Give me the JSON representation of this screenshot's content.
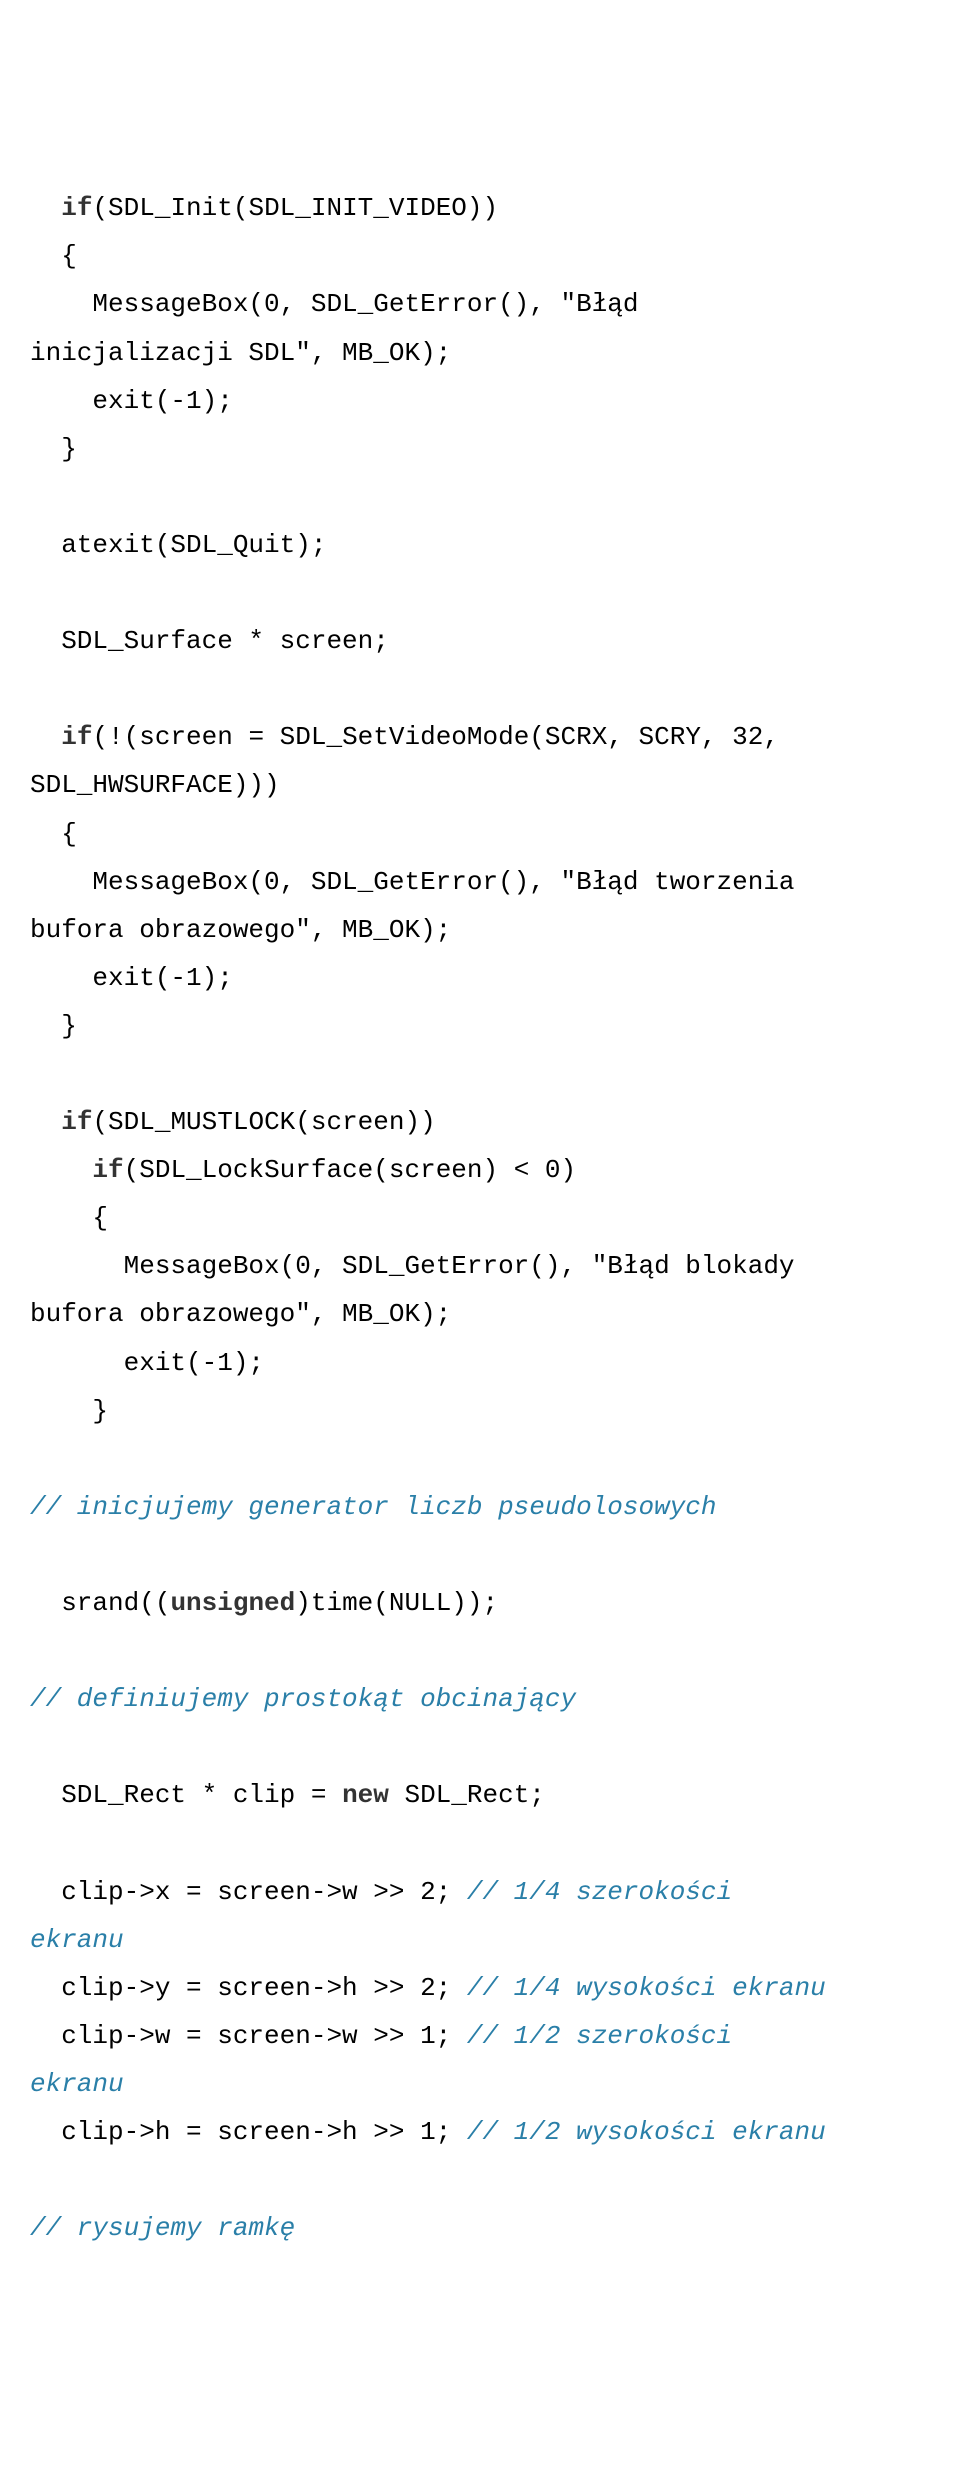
{
  "lines": [
    {
      "indent": 1,
      "segments": [
        {
          "t": "if",
          "c": "kw"
        },
        {
          "t": "(SDL_Init(SDL_INIT_VIDEO))"
        }
      ]
    },
    {
      "indent": 1,
      "segments": [
        {
          "t": "{"
        }
      ]
    },
    {
      "indent": 2,
      "segments": [
        {
          "t": "MessageBox(0, SDL_GetError(), \"Błąd "
        }
      ]
    },
    {
      "indent": 0,
      "segments": [
        {
          "t": "inicjalizacji SDL\", MB_OK);"
        }
      ]
    },
    {
      "indent": 2,
      "segments": [
        {
          "t": "exit(-1);"
        }
      ]
    },
    {
      "indent": 1,
      "segments": [
        {
          "t": "}"
        }
      ]
    },
    {
      "indent": 0,
      "segments": [
        {
          "t": ""
        }
      ]
    },
    {
      "indent": 1,
      "segments": [
        {
          "t": "atexit(SDL_Quit);"
        }
      ]
    },
    {
      "indent": 0,
      "segments": [
        {
          "t": ""
        }
      ]
    },
    {
      "indent": 1,
      "segments": [
        {
          "t": "SDL_Surface * screen;"
        }
      ]
    },
    {
      "indent": 0,
      "segments": [
        {
          "t": ""
        }
      ]
    },
    {
      "indent": 1,
      "segments": [
        {
          "t": "if",
          "c": "kw"
        },
        {
          "t": "(!(screen = SDL_SetVideoMode(SCRX, SCRY, 32,"
        }
      ]
    },
    {
      "indent": 0,
      "segments": [
        {
          "t": "SDL_HWSURFACE)))"
        }
      ]
    },
    {
      "indent": 1,
      "segments": [
        {
          "t": "{"
        }
      ]
    },
    {
      "indent": 2,
      "segments": [
        {
          "t": "MessageBox(0, SDL_GetError(), \"Błąd tworzenia"
        }
      ]
    },
    {
      "indent": 0,
      "segments": [
        {
          "t": "bufora obrazowego\", MB_OK);"
        }
      ]
    },
    {
      "indent": 2,
      "segments": [
        {
          "t": "exit(-1);"
        }
      ]
    },
    {
      "indent": 1,
      "segments": [
        {
          "t": "}"
        }
      ]
    },
    {
      "indent": 0,
      "segments": [
        {
          "t": ""
        }
      ]
    },
    {
      "indent": 1,
      "segments": [
        {
          "t": "if",
          "c": "kw"
        },
        {
          "t": "(SDL_MUSTLOCK(screen))"
        }
      ]
    },
    {
      "indent": 2,
      "segments": [
        {
          "t": "if",
          "c": "kw"
        },
        {
          "t": "(SDL_LockSurface(screen) < 0)"
        }
      ]
    },
    {
      "indent": 2,
      "segments": [
        {
          "t": "{"
        }
      ]
    },
    {
      "indent": 3,
      "segments": [
        {
          "t": "MessageBox(0, SDL_GetError(), \"Błąd blokady"
        }
      ]
    },
    {
      "indent": 0,
      "segments": [
        {
          "t": "bufora obrazowego\", MB_OK);"
        }
      ]
    },
    {
      "indent": 3,
      "segments": [
        {
          "t": "exit(-1);"
        }
      ]
    },
    {
      "indent": 2,
      "segments": [
        {
          "t": "}"
        }
      ]
    },
    {
      "indent": 0,
      "segments": [
        {
          "t": ""
        }
      ]
    },
    {
      "indent": 0,
      "segments": [
        {
          "t": "// inicjujemy generator liczb pseudolosowych",
          "c": "comment"
        }
      ]
    },
    {
      "indent": 0,
      "segments": [
        {
          "t": ""
        }
      ]
    },
    {
      "indent": 1,
      "segments": [
        {
          "t": "srand(("
        },
        {
          "t": "unsigned",
          "c": "kw"
        },
        {
          "t": ")time(NULL));"
        }
      ]
    },
    {
      "indent": 0,
      "segments": [
        {
          "t": ""
        }
      ]
    },
    {
      "indent": 0,
      "segments": [
        {
          "t": "// definiujemy prostokąt obcinający",
          "c": "comment"
        }
      ]
    },
    {
      "indent": 0,
      "segments": [
        {
          "t": ""
        }
      ]
    },
    {
      "indent": 1,
      "segments": [
        {
          "t": "SDL_Rect * clip = "
        },
        {
          "t": "new",
          "c": "kw"
        },
        {
          "t": " SDL_Rect;"
        }
      ]
    },
    {
      "indent": 0,
      "segments": [
        {
          "t": ""
        }
      ]
    },
    {
      "indent": 1,
      "segments": [
        {
          "t": "clip->x = screen->w >> 2; "
        },
        {
          "t": "// 1/4 szerokości ",
          "c": "comment"
        }
      ]
    },
    {
      "indent": 0,
      "segments": [
        {
          "t": "ekranu",
          "c": "comment"
        }
      ]
    },
    {
      "indent": 1,
      "segments": [
        {
          "t": "clip->y = screen->h >> 2; "
        },
        {
          "t": "// 1/4 wysokości ekranu",
          "c": "comment"
        }
      ]
    },
    {
      "indent": 1,
      "segments": [
        {
          "t": "clip->w = screen->w >> 1; "
        },
        {
          "t": "// 1/2 szerokości ",
          "c": "comment"
        }
      ]
    },
    {
      "indent": 0,
      "segments": [
        {
          "t": "ekranu",
          "c": "comment"
        }
      ]
    },
    {
      "indent": 1,
      "segments": [
        {
          "t": "clip->h = screen->h >> 1; "
        },
        {
          "t": "// 1/2 wysokości ekranu",
          "c": "comment"
        }
      ]
    },
    {
      "indent": 0,
      "segments": [
        {
          "t": ""
        }
      ]
    },
    {
      "indent": 0,
      "segments": [
        {
          "t": "// rysujemy ramkę",
          "c": "comment"
        }
      ]
    }
  ],
  "indent_unit": "  "
}
